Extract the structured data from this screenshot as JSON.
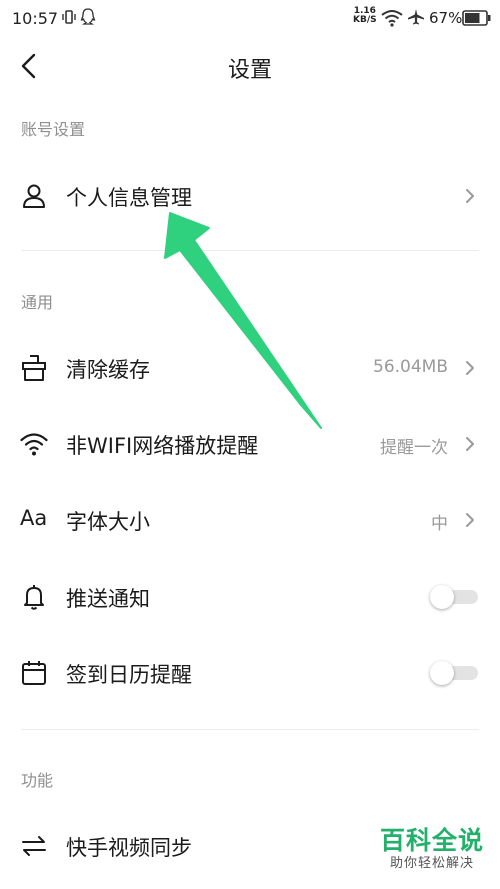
{
  "status_bar": {
    "time": "10:57",
    "net_speed_value": "1.16",
    "net_speed_unit": "KB/S",
    "battery_percent": "67%"
  },
  "header": {
    "title": "设置"
  },
  "sections": {
    "account": {
      "header": "账号设置"
    },
    "general": {
      "header": "通用"
    },
    "features": {
      "header": "功能"
    }
  },
  "rows": {
    "personal_info": {
      "label": "个人信息管理",
      "icon": "person-icon"
    },
    "clear_cache": {
      "label": "清除缓存",
      "value": "56.04MB",
      "icon": "broom-icon"
    },
    "non_wifi_reminder": {
      "label": "非WIFI网络播放提醒",
      "value": "提醒一次",
      "icon": "wifi-icon"
    },
    "font_size": {
      "label": "字体大小",
      "value": "中",
      "icon": "font-size-icon"
    },
    "push_notification": {
      "label": "推送通知",
      "enabled": false,
      "icon": "bell-icon"
    },
    "checkin_calendar": {
      "label": "签到日历提醒",
      "enabled": false,
      "icon": "calendar-icon"
    },
    "sync_kuaishou": {
      "label": "快手视频同步",
      "icon": "swap-arrows-icon"
    }
  },
  "font_icon_text": "Aa",
  "watermark": {
    "title": "百科全说",
    "subtitle": "助你轻松解决"
  },
  "colors": {
    "annotation_arrow": "#2fd07e",
    "watermark_green": "#23b06a",
    "section_header": "#8f8f8f",
    "value_text": "#9a9a9a"
  }
}
